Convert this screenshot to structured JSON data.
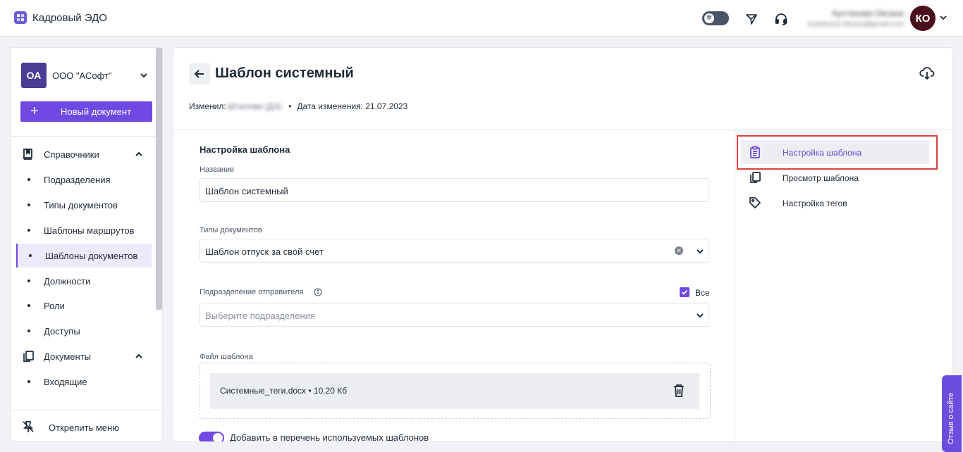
{
  "app": {
    "title": "Кадровый ЭДО"
  },
  "header": {
    "user_name": "Кустанова Оксана",
    "user_email": "kustanova.oksana@gmail.com",
    "avatar_initials": "КО"
  },
  "sidebar": {
    "org_initials": "ОА",
    "org_name": "ООО \"АСофт\"",
    "new_doc_label": "Новый документ",
    "group_reference": "Справочники",
    "reference_items": [
      "Подразделения",
      "Типы документов",
      "Шаблоны маршрутов",
      "Шаблоны документов",
      "Должности",
      "Роли",
      "Доступы"
    ],
    "active_item": "Шаблоны документов",
    "group_documents": "Документы",
    "document_items": [
      "Входящие"
    ],
    "unpin_label": "Открепить меню"
  },
  "page": {
    "title": "Шаблон системный",
    "changed_by_label": "Изменил:",
    "changed_by_value": "Шталова (ДЗ)",
    "date_label": "Дата изменения: 21.07.2023",
    "separator": "•"
  },
  "form": {
    "section_title": "Настройка шаблона",
    "name_label": "Название",
    "name_value": "Шаблон системный",
    "doc_types_label": "Типы документов",
    "doc_types_value": "Шаблон отпуск за свой счет",
    "sender_dept_label": "Подразделение отправителя",
    "sender_dept_placeholder": "Выберите подразделения",
    "all_label": "Все",
    "all_checked": true,
    "file_label": "Файл шаблона",
    "file_name": "Системные_теги.docx  •  10.20 Кб",
    "add_to_list_label": "Добавить в перечень используемых шаблонов",
    "add_to_list_on": true
  },
  "right_nav": {
    "items": [
      "Настройка шаблона",
      "Просмотр шаблона",
      "Настройка тегов"
    ],
    "active": "Настройка шаблона"
  },
  "feedback": {
    "label": "Отзыв о сайте"
  },
  "colors": {
    "accent": "#7049e3",
    "highlight_border": "#e0403c",
    "avatar_bg": "#4a0f1a",
    "org_badge_bg": "#4b3d95"
  }
}
